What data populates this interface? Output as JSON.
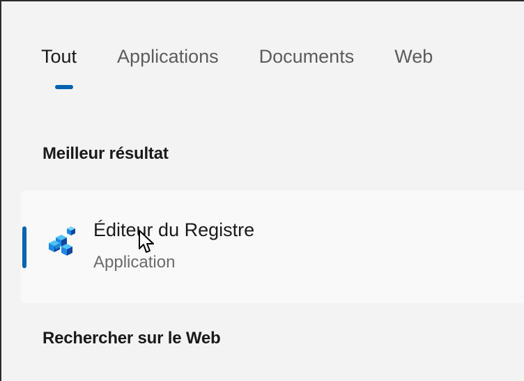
{
  "tabs": [
    {
      "label": "Tout",
      "active": true
    },
    {
      "label": "Applications",
      "active": false
    },
    {
      "label": "Documents",
      "active": false
    },
    {
      "label": "Web",
      "active": false
    }
  ],
  "best_match": {
    "section_title": "Meilleur résultat",
    "result": {
      "name": "Éditeur du Registre",
      "type": "Application",
      "icon": "registry-editor-icon"
    }
  },
  "web_search": {
    "section_title": "Rechercher sur le Web"
  },
  "colors": {
    "accent": "#0063b1",
    "background": "#f3f3f3",
    "card": "#f9f9f9",
    "text_primary": "#1a1a1a",
    "text_secondary": "#5c5c5c"
  }
}
